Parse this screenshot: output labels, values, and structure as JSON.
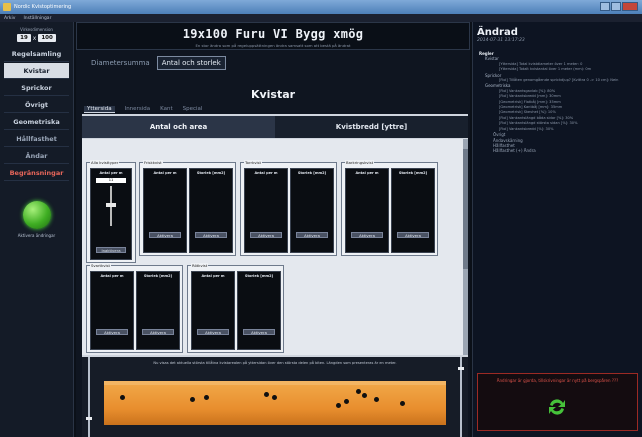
{
  "window": {
    "title": "Nordic Kvistoptimering"
  },
  "menu": [
    "Arkiv",
    "Inställningar"
  ],
  "sidebar": {
    "size_label": "Virkesdimension",
    "size_a": "19",
    "size_sep": "x",
    "size_b": "100",
    "items": [
      {
        "label": "Regelsamling",
        "state": "normal"
      },
      {
        "label": "Kvistar",
        "state": "active"
      },
      {
        "label": "Sprickor",
        "state": "normal"
      },
      {
        "label": "Övrigt",
        "state": "normal"
      },
      {
        "label": "Geometriska",
        "state": "normal"
      },
      {
        "label": "Hållfasthet",
        "state": "dim"
      },
      {
        "label": "Ändar",
        "state": "dim"
      },
      {
        "label": "Begränsningar",
        "state": "red"
      }
    ],
    "green_button_label": "Aktivera ändringar"
  },
  "header": {
    "title": "19x100 Furu VI Bygg xmög",
    "subtitle": "En stor ändra som på regeluppsättningen ändra samsatt som att bestä på ändrat"
  },
  "tabs": [
    "Diametersumma",
    "Antal och storlek"
  ],
  "section_title": "Kvistar",
  "subtabs": [
    "Yttersida",
    "Innersida",
    "Kant",
    "Special"
  ],
  "segments": [
    "Antal och area",
    "Kvistbredd [yttre]"
  ],
  "groups": [
    {
      "title": "Alla kvisttyper"
    },
    {
      "title": "Friskkvist",
      "col1": "Antal per m",
      "col2": "Storlek [mm2]"
    },
    {
      "title": "Torrkvist",
      "col1": "Antal per m",
      "col2": "Storlek [mm2]"
    },
    {
      "title": "Barkringskvist",
      "col1": "Antal per m",
      "col2": "Storlek [mm2]"
    },
    {
      "title": "Svartkvist",
      "col1": "Antal per m",
      "col2": "Storlek [mm2]"
    },
    {
      "title": "Rötkvist",
      "col1": "Antal per m",
      "col2": "Storlek [mm2]"
    }
  ],
  "all_knots": {
    "header": "Antal per m",
    "value": "11",
    "button": "Inaktivera"
  },
  "activate_label": "Aktivera",
  "bottom_note": "Nu visas det aktuella största tillåtna kvistarealen på yttersidan över den största delen på biten. Längden som presenteras är en meter.",
  "right": {
    "title": "Ändrad",
    "date": "2014-07-31 13:17:23",
    "tree": [
      {
        "level": "hdr",
        "text": "Regler"
      },
      {
        "level": "l1",
        "text": "Kvistar"
      },
      {
        "level": "l3",
        "text": "[Yttersida] Total kvistdiameter över 1 meter: 0"
      },
      {
        "level": "l3",
        "text": "[Yttersida] Totalt kvistantal över 1 meter (mm): 0m"
      },
      {
        "level": "l1",
        "text": "Sprickor"
      },
      {
        "level": "l3",
        "text": "[Fiol] Tillåten genomgående sprickdjup? [Kvittra 0 -> 10 cm]: Nein"
      },
      {
        "level": "l1",
        "text": "Geometriska"
      },
      {
        "level": "l3",
        "text": "[Fiol] Vankantsgavlab [%]: 80%"
      },
      {
        "level": "l3",
        "text": "[Fiol] Vankantsbredd [mm]: 30mm"
      },
      {
        "level": "l3",
        "text": "[Geometrisk] Flatbåj [mm]: 35mm"
      },
      {
        "level": "l3",
        "text": "[Geometrisk] Kantbåj [mm]: 35mm"
      },
      {
        "level": "l3",
        "text": "[Geometrisk] Skevhet [%]: 10%"
      },
      {
        "level": "l3",
        "text": "[Fiol] Vankantslängd båda sidor [%]: 30%"
      },
      {
        "level": "l3",
        "text": "[Fiol] Vankantslängd största sidan [%]: 30%"
      },
      {
        "level": "l3",
        "text": "[Fiol] Vankantsbredd [%]: 30%"
      },
      {
        "level": "l2",
        "text": "Övrigt"
      },
      {
        "level": "l2",
        "text": "Ändavskärning"
      },
      {
        "level": "l2",
        "text": "Hållfasthet"
      },
      {
        "level": "l2",
        "text": "Hållfasthet (+) Ändra"
      }
    ],
    "warning": "Ändringar är gjorda, tillskrivningar är nytt på bergspåren ???"
  },
  "colors": {
    "accent_green": "#3fae23",
    "warning_red": "#e0534a",
    "board_orange": "#e88e2e"
  }
}
